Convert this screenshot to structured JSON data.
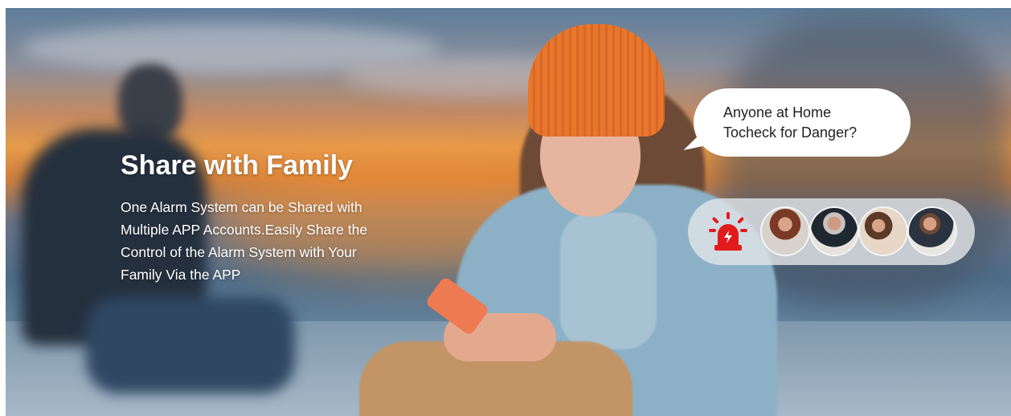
{
  "banner": {
    "headline": "Share with Family",
    "description_lines": [
      "One Alarm System can be Shared with",
      "Multiple APP Accounts.Easily Share the",
      "Control of the Alarm System with Your",
      "Family Via the APP"
    ]
  },
  "speech_bubble": {
    "lines": [
      "Anyone at Home",
      "Tocheck for Danger?"
    ]
  },
  "alerts": {
    "icon": "siren-alarm-icon",
    "avatars": [
      "woman-on-phone",
      "man-on-phone",
      "two-women-at-laptop",
      "man-on-phone-at-desk"
    ]
  },
  "colors": {
    "siren": "#e11b1b",
    "beanie": "#e8772b",
    "phone": "#ee7a52"
  }
}
